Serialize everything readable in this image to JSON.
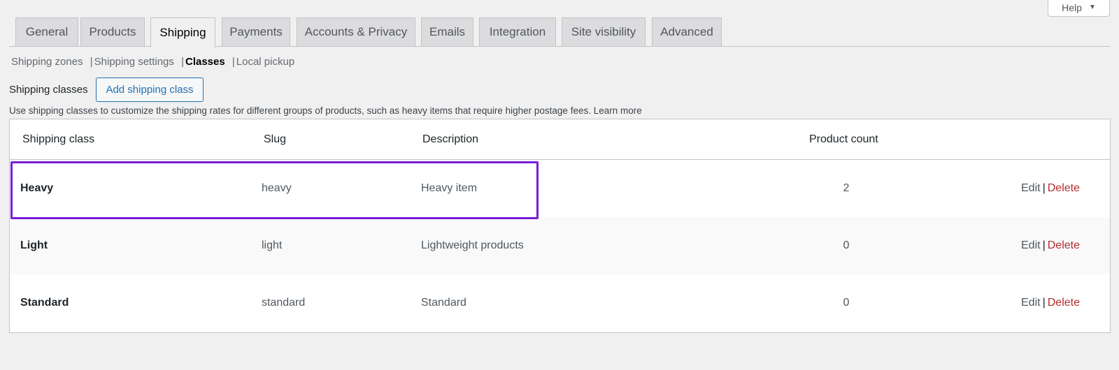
{
  "help": {
    "label": "Help",
    "caret": "▼"
  },
  "tabs": [
    {
      "label": "General"
    },
    {
      "label": "Products"
    },
    {
      "label": "Shipping"
    },
    {
      "label": "Payments"
    },
    {
      "label": "Accounts & Privacy"
    },
    {
      "label": "Emails"
    },
    {
      "label": "Integration"
    },
    {
      "label": "Site visibility"
    },
    {
      "label": "Advanced"
    }
  ],
  "active_tab": "Shipping",
  "subnav": {
    "zones": "Shipping zones",
    "settings": "Shipping settings",
    "classes": "Classes",
    "pickup": "Local pickup",
    "sep": "|"
  },
  "header": {
    "label": "Shipping classes",
    "add_button": "Add shipping class",
    "description": "Use shipping classes to customize the shipping rates for different groups of products, such as heavy items that require higher postage fees. Learn more"
  },
  "table": {
    "columns": [
      "Shipping class",
      "Slug",
      "Description",
      "Product count"
    ],
    "rows": [
      {
        "name": "Heavy",
        "slug": "heavy",
        "description": "Heavy item",
        "count": "2"
      },
      {
        "name": "Light",
        "slug": "light",
        "description": "Lightweight products",
        "count": "0"
      },
      {
        "name": "Standard",
        "slug": "standard",
        "description": "Standard",
        "count": "0"
      }
    ],
    "actions": {
      "edit": "Edit",
      "sep": "|",
      "delete": "Delete"
    }
  },
  "colors": {
    "highlight": "#7a1dd8",
    "link": "#2271b1",
    "delete": "#b32d2e"
  }
}
